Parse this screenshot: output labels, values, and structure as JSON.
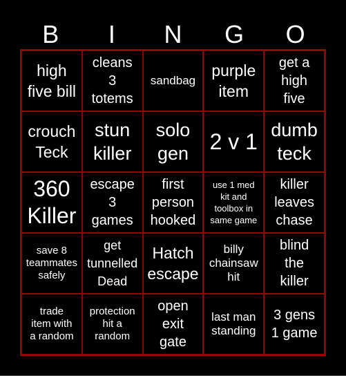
{
  "header": {
    "letters": [
      "B",
      "I",
      "N",
      "G",
      "O"
    ]
  },
  "colors": {
    "background": "#000000",
    "grid_line": "#990000",
    "text": "#ffffff"
  },
  "board": {
    "rows": [
      [
        "high\nfive bill",
        "cleans\n3\ntotems",
        "sandbag",
        "purple\nitem",
        "get a\nhigh\nfive"
      ],
      [
        "crouch\nTeck",
        "stun\nkiller",
        "solo\ngen",
        "2 v 1",
        "dumb\nteck"
      ],
      [
        "360\nKiller",
        "escape\n3\ngames",
        "first\nperson\nhooked",
        "use 1 med\nkit and\ntoolbox in\nsame game",
        "killer\nleaves\nchase"
      ],
      [
        "save 8\nteammates\nsafely",
        "get\ntunnelled\nDead",
        "Hatch\nescape",
        "billy\nchainsaw\nhit",
        "blind\nthe\nkiller"
      ],
      [
        "trade\nitem with\na random",
        "protection\nhit a\nrandom",
        "open\nexit\ngate",
        "last man\nstanding",
        "3 gens\n1 game"
      ]
    ]
  }
}
